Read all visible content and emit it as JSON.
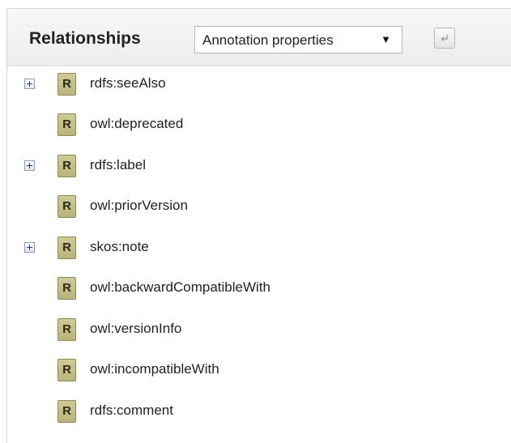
{
  "header": {
    "title": "Relationships",
    "dropdown_selected": "Annotation properties",
    "dropdown_arrow": "▼"
  },
  "relationships": [
    {
      "badge": "R",
      "label": "rdfs:seeAlso",
      "expandable": true
    },
    {
      "badge": "R",
      "label": "owl:deprecated",
      "expandable": false
    },
    {
      "badge": "R",
      "label": "rdfs:label",
      "expandable": true
    },
    {
      "badge": "R",
      "label": "owl:priorVersion",
      "expandable": false
    },
    {
      "badge": "R",
      "label": "skos:note",
      "expandable": true
    },
    {
      "badge": "R",
      "label": "owl:backwardCompatibleWith",
      "expandable": false
    },
    {
      "badge": "R",
      "label": "owl:versionInfo",
      "expandable": false
    },
    {
      "badge": "R",
      "label": "owl:incompatibleWith",
      "expandable": false
    },
    {
      "badge": "R",
      "label": "rdfs:comment",
      "expandable": false
    }
  ],
  "icons": {
    "expander": "plus-square-icon",
    "badge": "relationship-badge-icon",
    "refresh": "refresh-icon"
  },
  "colors": {
    "badge_fill": "#c4c08a",
    "badge_border": "#8e8a55",
    "header_bg": "#f2f2f2"
  }
}
